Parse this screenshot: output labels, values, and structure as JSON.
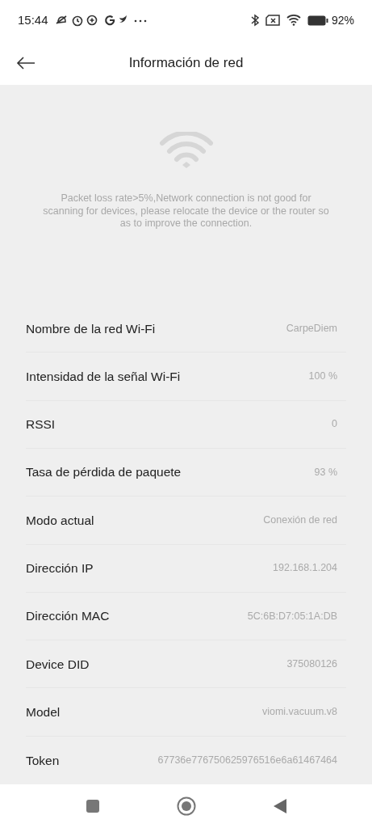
{
  "status_bar": {
    "time": "15:44",
    "battery": "92%"
  },
  "header": {
    "title": "Información de red"
  },
  "warning": {
    "message": "Packet loss rate>5%,Network connection is not good for scanning for devices, please relocate the device or the router so as to improve the connection."
  },
  "info_rows": [
    {
      "label": "Nombre de la red Wi-Fi",
      "value": "CarpeDiem"
    },
    {
      "label": "Intensidad de la señal Wi-Fi",
      "value": "100 %"
    },
    {
      "label": "RSSI",
      "value": "0"
    },
    {
      "label": "Tasa de pérdida de paquete",
      "value": "93 %"
    },
    {
      "label": "Modo actual",
      "value": "Conexión de red"
    },
    {
      "label": "Dirección IP",
      "value": "192.168.1.204"
    },
    {
      "label": "Dirección MAC",
      "value": "5C:6B:D7:05:1A:DB"
    },
    {
      "label": "Device DID",
      "value": "375080126"
    },
    {
      "label": "Model",
      "value": "viomi.vacuum.v8"
    },
    {
      "label": "Token",
      "value": "67736e776750625976516e6a61467464"
    }
  ]
}
